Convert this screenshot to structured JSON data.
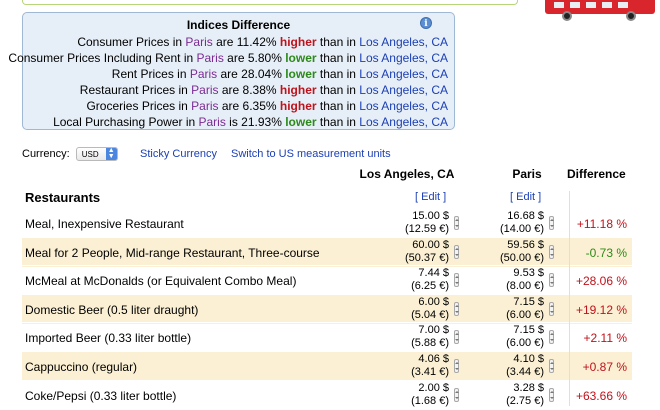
{
  "indices": {
    "title": "Indices Difference",
    "rows": [
      {
        "pre": "Consumer Prices in ",
        "city": "Paris",
        "mid": " are 11.42% ",
        "dir": "higher",
        "post": " than in ",
        "city2": "Los Angeles, CA"
      },
      {
        "pre": "Consumer Prices Including Rent in ",
        "city": "Paris",
        "mid": " are 5.80% ",
        "dir": "lower",
        "post": " than in ",
        "city2": "Los Angeles, CA"
      },
      {
        "pre": "Rent Prices in ",
        "city": "Paris",
        "mid": " are 28.04% ",
        "dir": "lower",
        "post": " than in ",
        "city2": "Los Angeles, CA"
      },
      {
        "pre": "Restaurant Prices in ",
        "city": "Paris",
        "mid": " are 8.38% ",
        "dir": "higher",
        "post": " than in ",
        "city2": "Los Angeles, CA"
      },
      {
        "pre": "Groceries Prices in ",
        "city": "Paris",
        "mid": " are 6.35% ",
        "dir": "higher",
        "post": " than in ",
        "city2": "Los Angeles, CA"
      },
      {
        "pre": "Local Purchasing Power in ",
        "city": "Paris",
        "mid": " is 21.93% ",
        "dir": "lower",
        "post": " than in ",
        "city2": "Los Angeles, CA"
      }
    ],
    "info_icon": "info-icon"
  },
  "currency": {
    "label": "Currency:",
    "selected": "USD",
    "sticky_label": "Sticky Currency",
    "switch_label": "Switch to US measurement units"
  },
  "table": {
    "headers": {
      "city1": "Los Angeles, CA",
      "city2": "Paris",
      "diff": "Difference"
    },
    "section": "Restaurants",
    "edit_label": "[ Edit ]",
    "items": [
      {
        "name": "Meal, Inexpensive Restaurant",
        "la": "15.00 $",
        "la_eur": "(12.59 €)",
        "pa": "16.68 $",
        "pa_eur": "(14.00 €)",
        "diff": "+11.18 %",
        "sign": "pos"
      },
      {
        "name": "Meal for 2 People, Mid-range Restaurant, Three-course",
        "la": "60.00 $",
        "la_eur": "(50.37 €)",
        "pa": "59.56 $",
        "pa_eur": "(50.00 €)",
        "diff": "-0.73 %",
        "sign": "neg"
      },
      {
        "name": "McMeal at McDonalds (or Equivalent Combo Meal)",
        "la": "7.44 $",
        "la_eur": "(6.25 €)",
        "pa": "9.53 $",
        "pa_eur": "(8.00 €)",
        "diff": "+28.06 %",
        "sign": "pos"
      },
      {
        "name": "Domestic Beer (0.5 liter draught)",
        "la": "6.00 $",
        "la_eur": "(5.04 €)",
        "pa": "7.15 $",
        "pa_eur": "(6.00 €)",
        "diff": "+19.12 %",
        "sign": "pos"
      },
      {
        "name": "Imported Beer (0.33 liter bottle)",
        "la": "7.00 $",
        "la_eur": "(5.88 €)",
        "pa": "7.15 $",
        "pa_eur": "(6.00 €)",
        "diff": "+2.11 %",
        "sign": "pos"
      },
      {
        "name": "Cappuccino (regular)",
        "la": "4.06 $",
        "la_eur": "(3.41 €)",
        "pa": "4.10 $",
        "pa_eur": "(3.44 €)",
        "diff": "+0.87 %",
        "sign": "pos"
      },
      {
        "name": "Coke/Pepsi (0.33 liter bottle)",
        "la": "2.00 $",
        "la_eur": "(1.68 €)",
        "pa": "3.28 $",
        "pa_eur": "(2.75 €)",
        "diff": "+63.66 %",
        "sign": "pos"
      }
    ]
  },
  "colors": {
    "higher": "#c0121b",
    "lower": "#2d8a1a",
    "link": "#1b3fb4",
    "city": "#7b2b92",
    "alt_row": "#fbf0d3",
    "box_bg": "#e6eef7"
  }
}
